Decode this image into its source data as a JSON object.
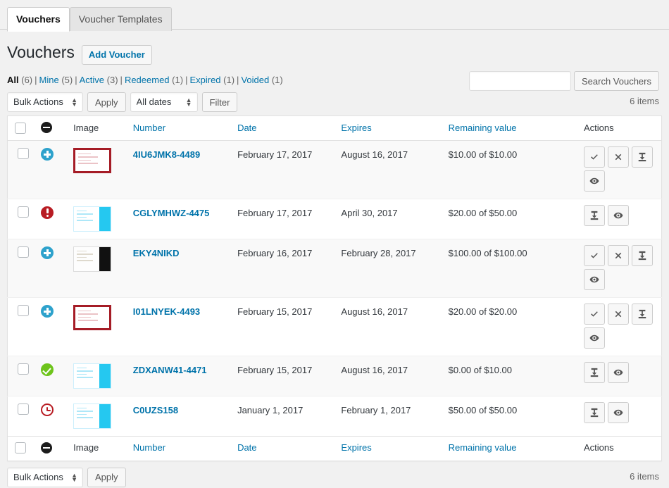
{
  "tabs": [
    {
      "label": "Vouchers",
      "active": true
    },
    {
      "label": "Voucher Templates",
      "active": false
    }
  ],
  "page": {
    "title": "Vouchers",
    "add_button": "Add Voucher"
  },
  "filters": [
    {
      "label": "All",
      "count": "(6)",
      "current": true
    },
    {
      "label": "Mine",
      "count": "(5)",
      "current": false
    },
    {
      "label": "Active",
      "count": "(3)",
      "current": false
    },
    {
      "label": "Redeemed",
      "count": "(1)",
      "current": false
    },
    {
      "label": "Expired",
      "count": "(1)",
      "current": false
    },
    {
      "label": "Voided",
      "count": "(1)",
      "current": false
    }
  ],
  "search": {
    "value": "",
    "placeholder": "",
    "button": "Search Vouchers"
  },
  "tablenav_top": {
    "bulk_actions": "Bulk Actions",
    "bulk_options": [
      "Bulk Actions"
    ],
    "apply": "Apply",
    "dates": "All dates",
    "dates_options": [
      "All dates"
    ],
    "filter": "Filter",
    "displaying": "6 items"
  },
  "tablenav_bottom": {
    "bulk_actions": "Bulk Actions",
    "apply": "Apply",
    "displaying": "6 items"
  },
  "table": {
    "columns": [
      {
        "key": "cb",
        "label": "",
        "sortable": false
      },
      {
        "key": "status",
        "label": "",
        "sortable": false,
        "icon": "status-dots-icon"
      },
      {
        "key": "image",
        "label": "Image",
        "sortable": false
      },
      {
        "key": "number",
        "label": "Number",
        "sortable": true
      },
      {
        "key": "date",
        "label": "Date",
        "sortable": true
      },
      {
        "key": "expires",
        "label": "Expires",
        "sortable": true
      },
      {
        "key": "remaining",
        "label": "Remaining value",
        "sortable": true
      },
      {
        "key": "actions",
        "label": "Actions",
        "sortable": false
      }
    ],
    "rows": [
      {
        "status": "active",
        "status_icon": "plus-circle-icon",
        "thumb": "red",
        "number": "4IU6JMK8-4489",
        "date": "February 17, 2017",
        "expires": "August 16, 2017",
        "remaining": "$10.00 of $10.00",
        "actions": [
          "check-icon",
          "cross-icon",
          "download-icon",
          "eye-icon"
        ]
      },
      {
        "status": "alert",
        "status_icon": "exclamation-circle-icon",
        "thumb": "cyan",
        "number": "CGLYMHWZ-4475",
        "date": "February 17, 2017",
        "expires": "April 30, 2017",
        "remaining": "$20.00 of $50.00",
        "actions": [
          "download-icon",
          "eye-icon"
        ]
      },
      {
        "status": "active",
        "status_icon": "plus-circle-icon",
        "thumb": "dark",
        "number": "EKY4NIKD",
        "date": "February 16, 2017",
        "expires": "February 28, 2017",
        "remaining": "$100.00 of $100.00",
        "actions": [
          "check-icon",
          "cross-icon",
          "download-icon",
          "eye-icon"
        ]
      },
      {
        "status": "active",
        "status_icon": "plus-circle-icon",
        "thumb": "red",
        "number": "I01LNYEK-4493",
        "date": "February 15, 2017",
        "expires": "August 16, 2017",
        "remaining": "$20.00 of $20.00",
        "actions": [
          "check-icon",
          "cross-icon",
          "download-icon",
          "eye-icon"
        ]
      },
      {
        "status": "redeemed",
        "status_icon": "check-circle-icon",
        "thumb": "cyan",
        "number": "ZDXANW41-4471",
        "date": "February 15, 2017",
        "expires": "August 16, 2017",
        "remaining": "$0.00 of $10.00",
        "actions": [
          "download-icon",
          "eye-icon"
        ]
      },
      {
        "status": "expired",
        "status_icon": "clock-circle-icon",
        "thumb": "cyan",
        "number": "C0UZS158",
        "date": "January 1, 2017",
        "expires": "February 1, 2017",
        "remaining": "$50.00 of $50.00",
        "actions": [
          "download-icon",
          "eye-icon"
        ]
      }
    ]
  },
  "colors": {
    "link": "#0073aa",
    "active": "#2ea2cc",
    "alert": "#b81c23",
    "redeemed": "#6ec41c",
    "expired": "#b81c23",
    "thumb_red": "#a51c26",
    "thumb_cyan": "#25c8f0"
  }
}
